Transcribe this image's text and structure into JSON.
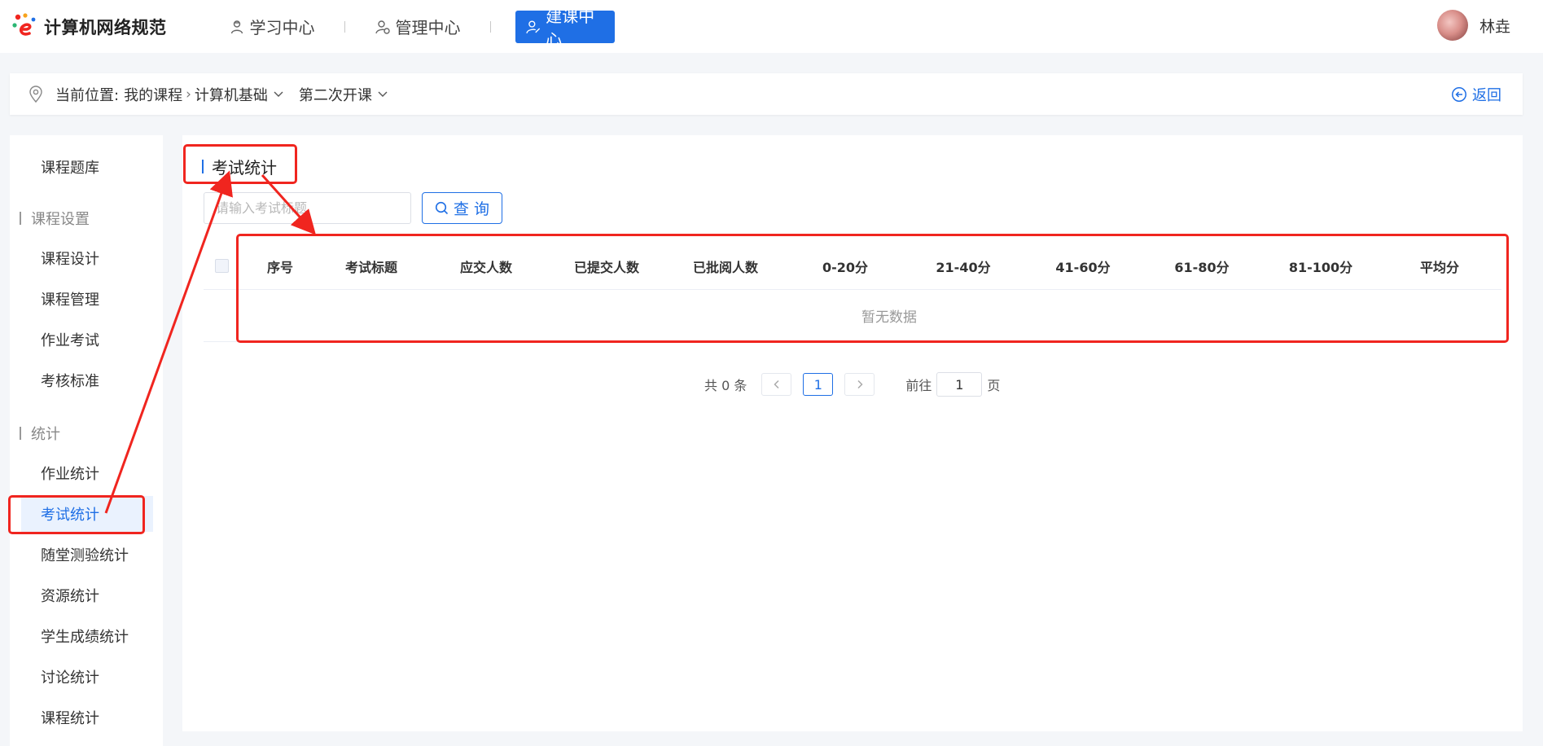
{
  "app": {
    "logo_text": "计算机网络规范"
  },
  "nav": {
    "items": [
      {
        "label": "学习中心",
        "icon": "learning-person-icon"
      },
      {
        "label": "管理中心",
        "icon": "manage-person-icon"
      },
      {
        "label": "建课中心",
        "icon": "build-person-icon",
        "active": true
      }
    ]
  },
  "user": {
    "name": "林垚"
  },
  "breadcrumb": {
    "label": "当前位置:",
    "items": [
      "我的课程",
      "计算机基础",
      "第二次开课"
    ],
    "back_label": "返回"
  },
  "sidebar": {
    "items": [
      {
        "type": "item",
        "label": "课程题库"
      },
      {
        "type": "group",
        "label": "课程设置"
      },
      {
        "type": "item",
        "label": "课程设计"
      },
      {
        "type": "item",
        "label": "课程管理"
      },
      {
        "type": "item",
        "label": "作业考试"
      },
      {
        "type": "item",
        "label": "考核标准"
      },
      {
        "type": "group",
        "label": "统计"
      },
      {
        "type": "item",
        "label": "作业统计"
      },
      {
        "type": "item",
        "label": "考试统计",
        "active": true
      },
      {
        "type": "item",
        "label": "随堂测验统计"
      },
      {
        "type": "item",
        "label": "资源统计"
      },
      {
        "type": "item",
        "label": "学生成绩统计"
      },
      {
        "type": "item",
        "label": "讨论统计"
      },
      {
        "type": "item",
        "label": "课程统计"
      }
    ]
  },
  "main": {
    "title": "考试统计",
    "search": {
      "placeholder": "请输入考试标题",
      "value": "",
      "button_label": "查 询"
    },
    "table": {
      "columns": [
        "序号",
        "考试标题",
        "应交人数",
        "已提交人数",
        "已批阅人数",
        "0-20分",
        "21-40分",
        "41-60分",
        "61-80分",
        "81-100分",
        "平均分"
      ],
      "empty_text": "暂无数据"
    },
    "pagination": {
      "total_label": "共 0 条",
      "current_page": "1",
      "goto_label": "前往",
      "goto_value": "1",
      "page_suffix": "页"
    }
  },
  "colors": {
    "accent": "#1f6fe5",
    "annotation": "#f0251f",
    "page_bg": "#f4f6f9"
  }
}
